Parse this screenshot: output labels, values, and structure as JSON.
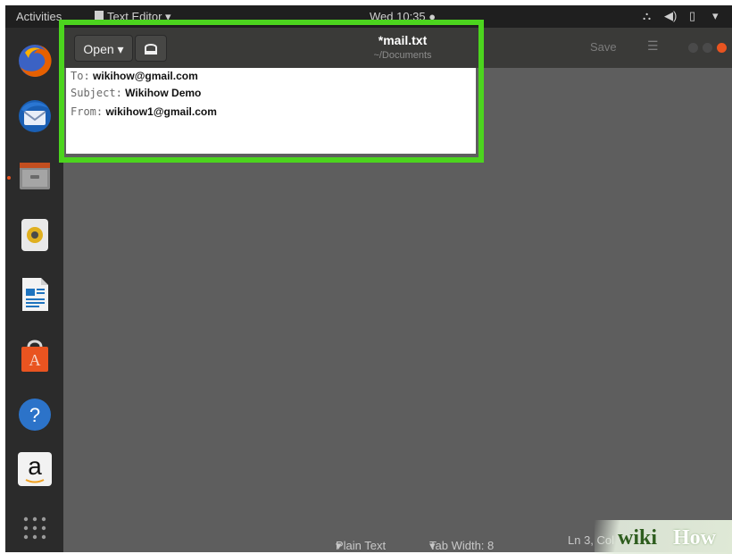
{
  "topbar": {
    "activities": "Activities",
    "app_menu": "Text Editor",
    "clock": "Wed 10:35"
  },
  "dock": [
    {
      "name": "firefox",
      "icon": "firefox-icon"
    },
    {
      "name": "thunderbird",
      "icon": "thunderbird-icon"
    },
    {
      "name": "files",
      "icon": "files-icon"
    },
    {
      "name": "rhythmbox",
      "icon": "rhythmbox-icon"
    },
    {
      "name": "libreoffice-writer",
      "icon": "writer-icon"
    },
    {
      "name": "software",
      "icon": "software-center-icon"
    },
    {
      "name": "help",
      "icon": "help-icon"
    },
    {
      "name": "amazon",
      "icon": "amazon-icon",
      "label": "a"
    },
    {
      "name": "show-applications",
      "icon": "app-grid-icon"
    }
  ],
  "window": {
    "open_label": "Open",
    "title": "*mail.txt",
    "path": "~/Documents",
    "save_label": "Save"
  },
  "editor": {
    "lines": [
      {
        "key": "To:",
        "value": "wikihow@gmail.com"
      },
      {
        "key": "Subject:",
        "value": "Wikihow Demo"
      },
      {
        "key": "From:",
        "value": "wikihow1@gmail.com"
      }
    ]
  },
  "statusbar": {
    "language": "Plain Text",
    "tab_width": "Tab Width: 8",
    "position": "Ln 3, Col"
  },
  "watermark": {
    "wiki": "wiki",
    "how": "How"
  },
  "colors": {
    "highlight": "#4cd41e",
    "ubuntu_orange": "#e95420"
  }
}
